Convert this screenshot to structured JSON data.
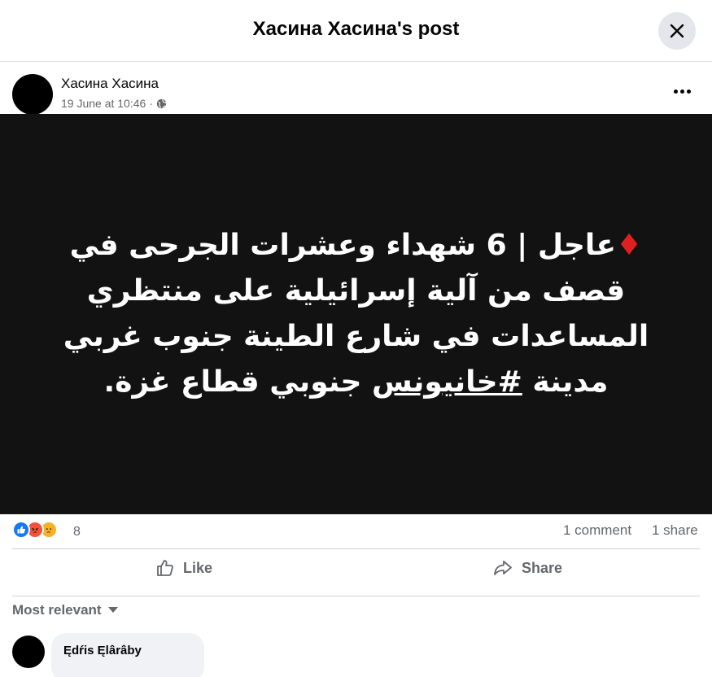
{
  "dialog": {
    "title": "Хасина Хасина's post",
    "close_icon": "close-icon"
  },
  "post": {
    "author": "Хасина Хасина",
    "timestamp": "19 June at 10:46",
    "separator": "·",
    "privacy_icon": "globe-icon",
    "menu_icon": "more-options-icon",
    "image_text": {
      "marker": "♦",
      "line1": "عاجل | 6 شهداء وعشرات الجرحى في قصف من آلية إسرائيلية على منتظري المساعدات في شارع الطينة جنوب غربي مدينة ",
      "hashtag": "#خانيونس",
      "line2": " جنوبي قطاع غزة."
    }
  },
  "stats": {
    "reaction_icons": [
      "like-reaction-icon",
      "angry-reaction-icon",
      "sad-reaction-icon"
    ],
    "reaction_count": "8",
    "comments": "1 comment",
    "shares": "1 share"
  },
  "actions": {
    "like_label": "Like",
    "share_label": "Share"
  },
  "comments_section": {
    "filter_label": "Most relevant",
    "comments": [
      {
        "author": "Ędŕis Ęlârâby"
      }
    ]
  },
  "colors": {
    "accent": "#1877f2",
    "image_background": "#121212",
    "diamond": "#e02020",
    "secondary_text": "#65676b"
  }
}
